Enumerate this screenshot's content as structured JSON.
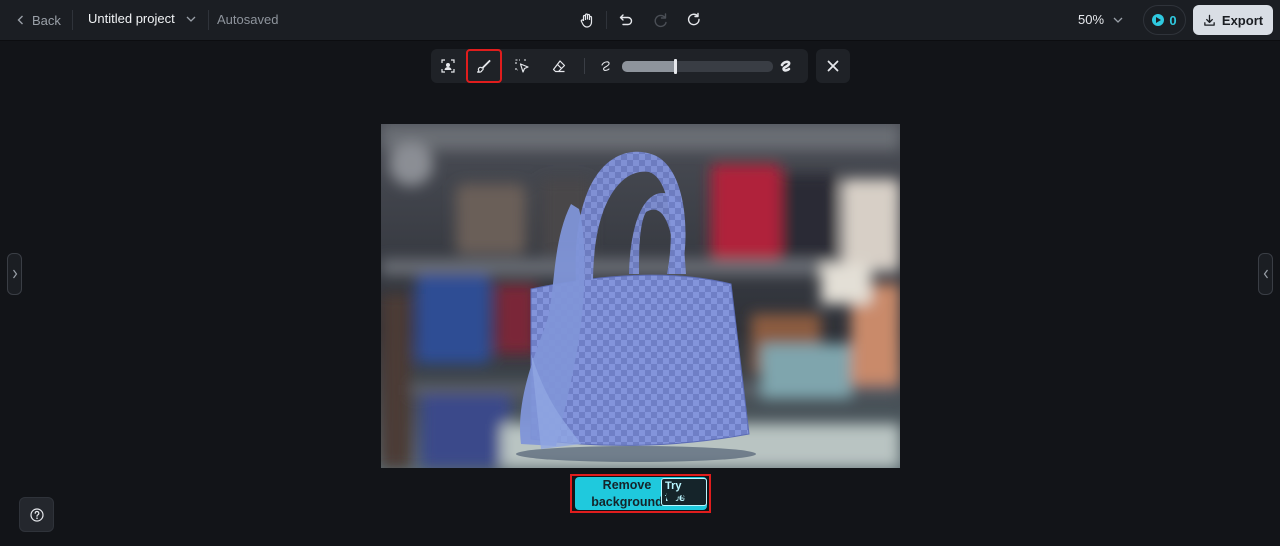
{
  "header": {
    "back_label": "Back",
    "project_name": "Untitled project",
    "save_status": "Autosaved",
    "zoom_level": "50%",
    "credits_count": "0",
    "export_label": "Export"
  },
  "toolbar": {
    "tools": [
      "subject-select-icon",
      "brush-icon",
      "smart-select-icon",
      "eraser-icon"
    ],
    "selected_tool": "brush-icon",
    "brush_size_fraction": 0.35
  },
  "action": {
    "remove_bg_label": "Remove background",
    "try_free_badge": "Try free",
    "cost": "0"
  },
  "colors": {
    "accent": "#1fc9dd",
    "selection_outline": "#e01d1d",
    "mask_overlay": "#6f86d9"
  }
}
